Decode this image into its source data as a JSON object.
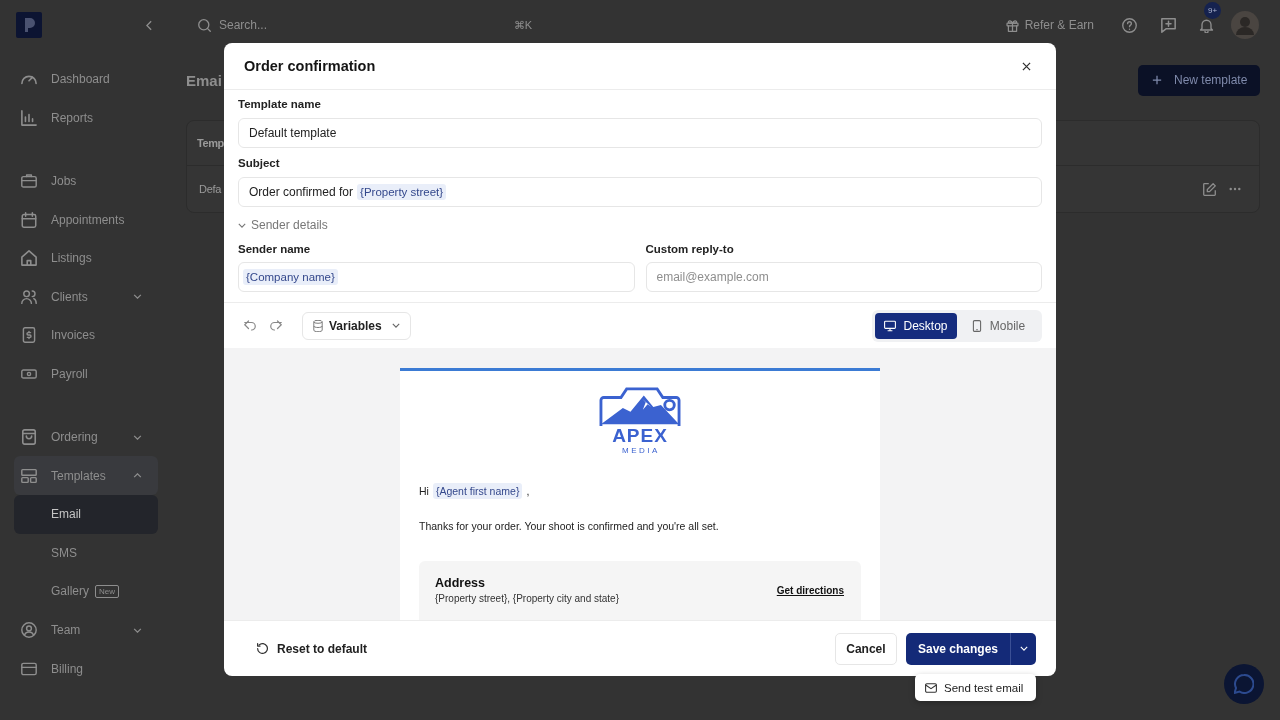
{
  "sidebar": {
    "sections": [
      {
        "items": [
          {
            "label": "Dashboard",
            "selected": false
          },
          {
            "label": "Reports",
            "selected": false
          }
        ]
      },
      {
        "items": [
          {
            "label": "Jobs",
            "selected": false
          },
          {
            "label": "Appointments",
            "selected": false
          },
          {
            "label": "Listings",
            "selected": false
          },
          {
            "label": "Clients",
            "selected": false,
            "expanded": false
          },
          {
            "label": "Invoices",
            "selected": false
          },
          {
            "label": "Payroll",
            "selected": false
          }
        ]
      },
      {
        "items": [
          {
            "label": "Ordering",
            "selected": false,
            "expanded": false
          },
          {
            "label": "Templates",
            "selected": false,
            "expanded": true,
            "children": [
              {
                "label": "Email",
                "selected": true
              },
              {
                "label": "SMS",
                "selected": false
              },
              {
                "label": "Gallery",
                "selected": false,
                "badge": "New"
              }
            ]
          },
          {
            "label": "Team",
            "selected": false,
            "expanded": false
          },
          {
            "label": "Billing",
            "selected": false
          }
        ]
      }
    ]
  },
  "top_bar": {
    "search": {
      "placeholder": "Search...",
      "shortcut": "⌘K"
    },
    "refer_button": "Refer & Earn",
    "notifications_badge": "9+"
  },
  "page": {
    "title": "Emai",
    "new_button": "New template",
    "table": {
      "columns": [
        "Temp"
      ],
      "rows": [
        [
          "Defa"
        ]
      ]
    }
  },
  "modal": {
    "title": "Order confirmation",
    "template_name": {
      "label": "Template name",
      "value": "Default template"
    },
    "subject": {
      "label": "Subject",
      "value": [
        {
          "kind": "text",
          "text": "Order confirmed for"
        },
        {
          "kind": "variable",
          "text": "{Property street}"
        }
      ]
    },
    "sender_details": {
      "label": "Sender details",
      "expanded": true,
      "sender_name": {
        "label": "Sender name",
        "value": [
          {
            "kind": "variable",
            "text": "{Company name}"
          }
        ]
      },
      "reply_to": {
        "label": "Custom reply-to",
        "placeholder": "email@example.com"
      }
    },
    "toolbar": {
      "variables_button": "Variables",
      "views": [
        {
          "label": "Desktop",
          "selected": true
        },
        {
          "label": "Mobile",
          "selected": false
        }
      ]
    },
    "preview": {
      "logo": {
        "name": "APEX",
        "tagline": "MEDIA"
      },
      "greeting": [
        {
          "kind": "text",
          "text": "Hi"
        },
        {
          "kind": "variable",
          "text": "{Agent first name}"
        },
        {
          "kind": "text",
          "text": ","
        }
      ],
      "body": "Thanks for your order. Your shoot is confirmed and you're all set.",
      "address_card": {
        "title": "Address",
        "value": "{Property street}, {Property city and state}",
        "link": "Get directions"
      }
    },
    "footer": {
      "reset_button": "Reset to default",
      "cancel_button": "Cancel",
      "save_button": "Save changes",
      "save_menu": [
        "Send test email"
      ]
    }
  }
}
